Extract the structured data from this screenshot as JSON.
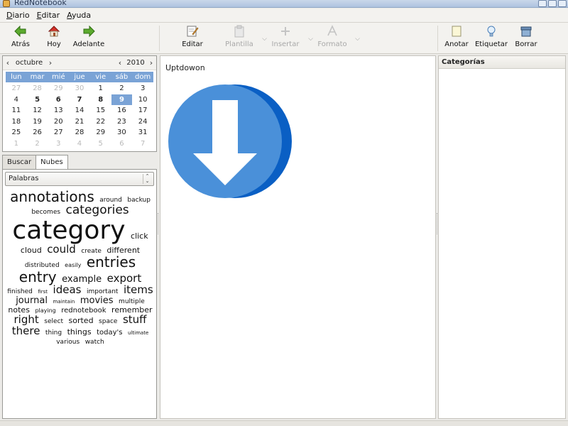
{
  "window": {
    "title": "RedNotebook"
  },
  "menu": [
    {
      "first": "D",
      "rest": "iario"
    },
    {
      "first": "E",
      "rest": "ditar"
    },
    {
      "first": "A",
      "rest": "yuda"
    }
  ],
  "toolbar": {
    "back": "Atrás",
    "today": "Hoy",
    "forward": "Adelante",
    "edit": "Editar",
    "template": "Plantilla",
    "insert": "Insertar",
    "format": "Formato",
    "annotate": "Anotar",
    "tag": "Etiquetar",
    "delete": "Borrar"
  },
  "calendar": {
    "month": "octubre",
    "year": "2010",
    "weekdays": [
      "lun",
      "mar",
      "mié",
      "jue",
      "vie",
      "sáb",
      "dom"
    ],
    "days": [
      {
        "d": "27",
        "t": "other"
      },
      {
        "d": "28",
        "t": "other"
      },
      {
        "d": "29",
        "t": "other"
      },
      {
        "d": "30",
        "t": "other"
      },
      {
        "d": "1",
        "t": ""
      },
      {
        "d": "2",
        "t": ""
      },
      {
        "d": "3",
        "t": ""
      },
      {
        "d": "4",
        "t": ""
      },
      {
        "d": "5",
        "t": "bold"
      },
      {
        "d": "6",
        "t": "bold"
      },
      {
        "d": "7",
        "t": "bold"
      },
      {
        "d": "8",
        "t": "bold"
      },
      {
        "d": "9",
        "t": "sel"
      },
      {
        "d": "10",
        "t": ""
      },
      {
        "d": "11",
        "t": ""
      },
      {
        "d": "12",
        "t": ""
      },
      {
        "d": "13",
        "t": ""
      },
      {
        "d": "14",
        "t": ""
      },
      {
        "d": "15",
        "t": ""
      },
      {
        "d": "16",
        "t": ""
      },
      {
        "d": "17",
        "t": ""
      },
      {
        "d": "18",
        "t": ""
      },
      {
        "d": "19",
        "t": ""
      },
      {
        "d": "20",
        "t": ""
      },
      {
        "d": "21",
        "t": ""
      },
      {
        "d": "22",
        "t": ""
      },
      {
        "d": "23",
        "t": ""
      },
      {
        "d": "24",
        "t": ""
      },
      {
        "d": "25",
        "t": ""
      },
      {
        "d": "26",
        "t": ""
      },
      {
        "d": "27",
        "t": ""
      },
      {
        "d": "28",
        "t": ""
      },
      {
        "d": "29",
        "t": ""
      },
      {
        "d": "30",
        "t": ""
      },
      {
        "d": "31",
        "t": ""
      },
      {
        "d": "1",
        "t": "other"
      },
      {
        "d": "2",
        "t": "other"
      },
      {
        "d": "3",
        "t": "other"
      },
      {
        "d": "4",
        "t": "other"
      },
      {
        "d": "5",
        "t": "other"
      },
      {
        "d": "6",
        "t": "other"
      },
      {
        "d": "7",
        "t": "other"
      }
    ]
  },
  "tabs": {
    "search": "Buscar",
    "clouds": "Nubes"
  },
  "cloud_filter": {
    "selected": "Palabras"
  },
  "cloud_words": [
    {
      "w": "annotations",
      "s": 20
    },
    {
      "w": "around",
      "s": 9
    },
    {
      "w": "backup",
      "s": 9
    },
    {
      "w": "becomes",
      "s": 9
    },
    {
      "w": "categories",
      "s": 17
    },
    {
      "w": "category",
      "s": 36
    },
    {
      "w": "click",
      "s": 11
    },
    {
      "w": "cloud",
      "s": 11
    },
    {
      "w": "could",
      "s": 15
    },
    {
      "w": "create",
      "s": 9
    },
    {
      "w": "different",
      "s": 11
    },
    {
      "w": "distributed",
      "s": 9
    },
    {
      "w": "easily",
      "s": 8
    },
    {
      "w": "entries",
      "s": 20
    },
    {
      "w": "entry",
      "s": 20
    },
    {
      "w": "example",
      "s": 13
    },
    {
      "w": "export",
      "s": 15
    },
    {
      "w": "finished",
      "s": 9
    },
    {
      "w": "first",
      "s": 7
    },
    {
      "w": "ideas",
      "s": 15
    },
    {
      "w": "important",
      "s": 9
    },
    {
      "w": "items",
      "s": 15
    },
    {
      "w": "journal",
      "s": 13
    },
    {
      "w": "maintain",
      "s": 7
    },
    {
      "w": "movies",
      "s": 13
    },
    {
      "w": "multiple",
      "s": 9
    },
    {
      "w": "notes",
      "s": 11
    },
    {
      "w": "playing",
      "s": 8
    },
    {
      "w": "rednotebook",
      "s": 10
    },
    {
      "w": "remember",
      "s": 11
    },
    {
      "w": "right",
      "s": 15
    },
    {
      "w": "select",
      "s": 9
    },
    {
      "w": "sorted",
      "s": 11
    },
    {
      "w": "space",
      "s": 9
    },
    {
      "w": "stuff",
      "s": 15
    },
    {
      "w": "there",
      "s": 15
    },
    {
      "w": "thing",
      "s": 9
    },
    {
      "w": "things",
      "s": 11
    },
    {
      "w": "today's",
      "s": 10
    },
    {
      "w": "ultimate",
      "s": 7
    },
    {
      "w": "various",
      "s": 9
    },
    {
      "w": "watch",
      "s": 9
    }
  ],
  "entry": {
    "text": "Uptdowon"
  },
  "right_panel": {
    "header": "Categorías"
  },
  "colors": {
    "accent": "#7aa3d6",
    "arrow_blue": "#4a90d9",
    "arrow_dark": "#0a5fc4"
  }
}
